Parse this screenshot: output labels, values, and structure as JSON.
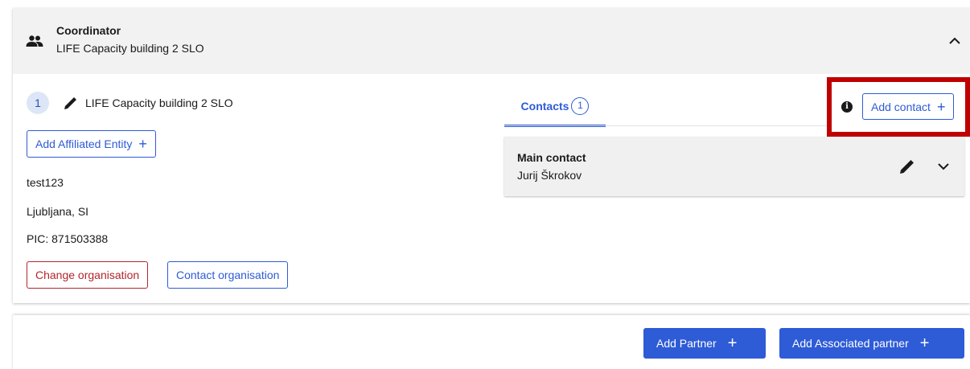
{
  "coordinator": {
    "title": "Coordinator",
    "subtitle": "LIFE Capacity building 2 SLO",
    "icon": "people-icon",
    "collapse_icon": "chevron-up-icon"
  },
  "entity": {
    "number": "1",
    "name": "LIFE Capacity building 2 SLO",
    "add_affiliated_label": "Add Affiliated Entity",
    "plus": "+",
    "details": [
      "test123",
      "Ljubljana, SI",
      "PIC: 871503388"
    ],
    "change_org_label": "Change organisation",
    "contact_org_label": "Contact organisation"
  },
  "contacts": {
    "tab_label": "Contacts",
    "tab_count": "1",
    "info_icon": "i",
    "add_contact_label": "Add contact",
    "plus": "+",
    "card": {
      "title": "Main contact",
      "name": "Jurij Škrokov"
    }
  },
  "footer": {
    "add_partner_label": "Add Partner",
    "add_associated_label": "Add Associated partner",
    "plus": "+"
  },
  "colors": {
    "primary": "#2e5bd6",
    "danger": "#b3262d",
    "highlight": "#c00000",
    "header_bg": "#f2f2f2"
  }
}
